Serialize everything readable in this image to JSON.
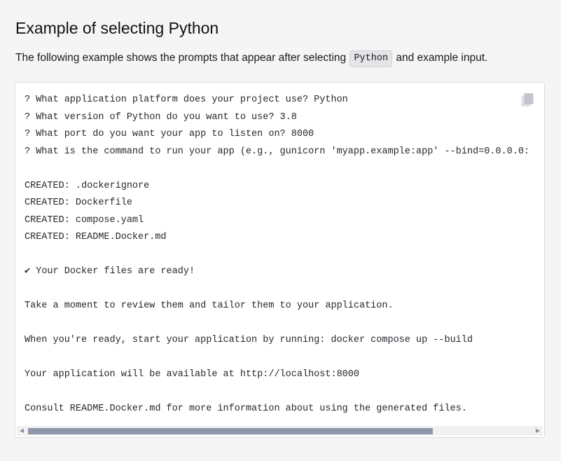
{
  "section": {
    "heading": "Example of selecting Python",
    "intro_before": "The following example shows the prompts that appear after selecting ",
    "intro_code": "Python",
    "intro_after": " and example input."
  },
  "code_block": {
    "lines": [
      "? What application platform does your project use? Python",
      "? What version of Python do you want to use? 3.8",
      "? What port do you want your app to listen on? 8000",
      "? What is the command to run your app (e.g., gunicorn 'myapp.example:app' --bind=0.0.0.0:",
      "",
      "CREATED: .dockerignore",
      "CREATED: Dockerfile",
      "CREATED: compose.yaml",
      "CREATED: README.Docker.md",
      "",
      "✔ Your Docker files are ready!",
      "",
      "Take a moment to review them and tailor them to your application.",
      "",
      "When you're ready, start your application by running: docker compose up --build",
      "",
      "Your application will be available at http://localhost:8000",
      "",
      "Consult README.Docker.md for more information about using the generated files."
    ],
    "copy_icon": "copy-icon",
    "scroll_left_icon": "scroll-left-arrow-icon",
    "scroll_right_icon": "scroll-right-arrow-icon",
    "scroll_left_glyph": "◀",
    "scroll_right_glyph": "▶"
  },
  "colors": {
    "page_background": "#f5f5f6",
    "code_background": "#ffffff",
    "code_border": "#d9dadd",
    "inline_code_background": "#e4e5e8",
    "scroll_thumb": "#8e97a8",
    "copy_icon": "#c2c6cc"
  }
}
